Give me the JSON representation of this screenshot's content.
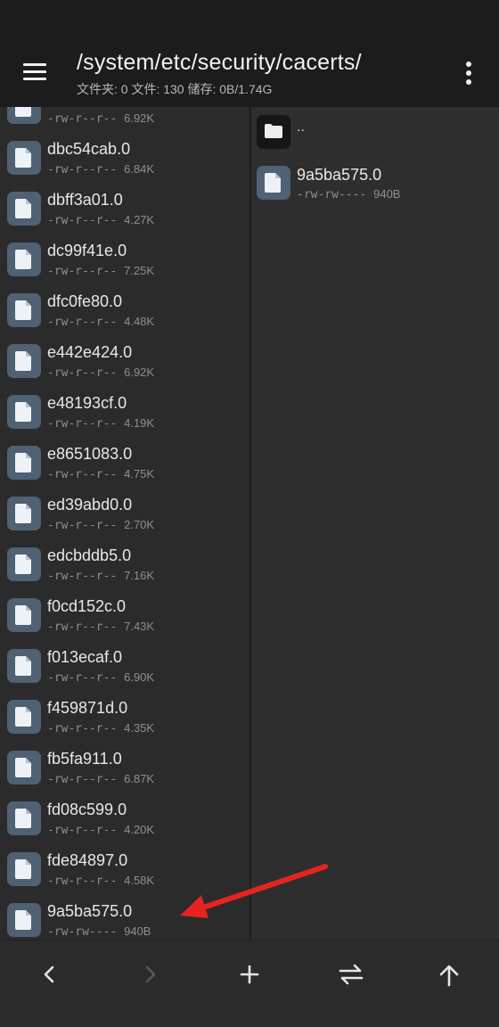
{
  "header": {
    "path": "/system/etc/security/cacerts/",
    "subtitle": "文件夹: 0  文件: 130  储存: 0B/1.74G"
  },
  "left_pane": {
    "partial_top_row": {
      "meta": "-rw-r--r--",
      "size": "6.92K"
    },
    "files": [
      {
        "name": "dbc54cab.0",
        "perms": "-rw-r--r--",
        "size": "6.84K"
      },
      {
        "name": "dbff3a01.0",
        "perms": "-rw-r--r--",
        "size": "4.27K"
      },
      {
        "name": "dc99f41e.0",
        "perms": "-rw-r--r--",
        "size": "7.25K"
      },
      {
        "name": "dfc0fe80.0",
        "perms": "-rw-r--r--",
        "size": "4.48K"
      },
      {
        "name": "e442e424.0",
        "perms": "-rw-r--r--",
        "size": "6.92K"
      },
      {
        "name": "e48193cf.0",
        "perms": "-rw-r--r--",
        "size": "4.19K"
      },
      {
        "name": "e8651083.0",
        "perms": "-rw-r--r--",
        "size": "4.75K"
      },
      {
        "name": "ed39abd0.0",
        "perms": "-rw-r--r--",
        "size": "2.70K"
      },
      {
        "name": "edcbddb5.0",
        "perms": "-rw-r--r--",
        "size": "7.16K"
      },
      {
        "name": "f0cd152c.0",
        "perms": "-rw-r--r--",
        "size": "7.43K"
      },
      {
        "name": "f013ecaf.0",
        "perms": "-rw-r--r--",
        "size": "6.90K"
      },
      {
        "name": "f459871d.0",
        "perms": "-rw-r--r--",
        "size": "4.35K"
      },
      {
        "name": "fb5fa911.0",
        "perms": "-rw-r--r--",
        "size": "6.87K"
      },
      {
        "name": "fd08c599.0",
        "perms": "-rw-r--r--",
        "size": "4.20K"
      },
      {
        "name": "fde84897.0",
        "perms": "-rw-r--r--",
        "size": "4.58K"
      },
      {
        "name": "9a5ba575.0",
        "perms": "-rw-rw----",
        "size": "940B"
      }
    ]
  },
  "right_pane": {
    "parent_label": "..",
    "file": {
      "name": "9a5ba575.0",
      "perms": "-rw-rw----",
      "size": "940B"
    }
  },
  "icons": {
    "menu": "hamburger-menu-icon",
    "overflow": "more-vert-icon",
    "file": "file-icon",
    "folder": "folder-icon",
    "back": "chevron-left-icon",
    "forward": "chevron-right-icon",
    "add": "plus-icon",
    "swap": "swap-arrows-icon",
    "up": "arrow-up-icon"
  },
  "colors": {
    "app_bar": "#1c1c1c",
    "background": "#2b2b2b",
    "file_icon": "#4f6173",
    "annotation_arrow": "#e8231f"
  }
}
